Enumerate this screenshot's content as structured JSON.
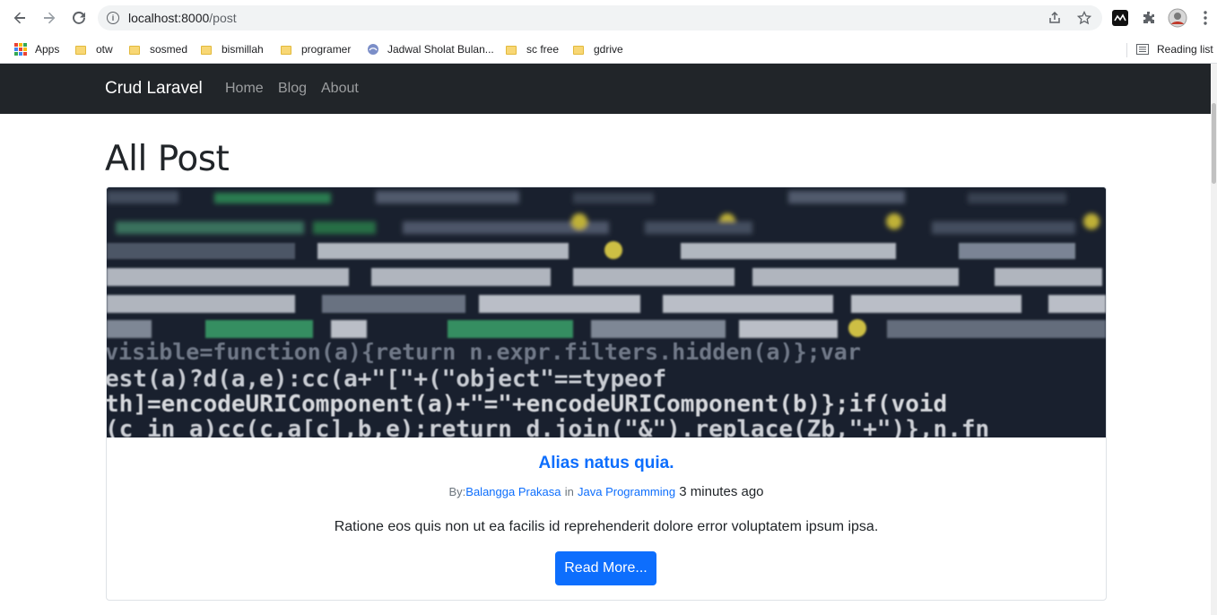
{
  "browser": {
    "url_host": "localhost:8000",
    "url_path": "/post",
    "bookmarks": [
      {
        "label": "Apps",
        "type": "apps"
      },
      {
        "label": "otw",
        "type": "folder"
      },
      {
        "label": "sosmed",
        "type": "folder"
      },
      {
        "label": "bismillah",
        "type": "folder"
      },
      {
        "label": "programer",
        "type": "folder"
      },
      {
        "label": "Jadwal Sholat Bulan...",
        "type": "site"
      },
      {
        "label": "sc free",
        "type": "folder"
      },
      {
        "label": "gdrive",
        "type": "folder"
      }
    ],
    "reading_list": "Reading list"
  },
  "navbar": {
    "brand": "Crud Laravel",
    "links": [
      "Home",
      "Blog",
      "About"
    ]
  },
  "main": {
    "title": "All Post"
  },
  "post": {
    "title": "Alias natus quia.",
    "by_label": "By:",
    "author": "Balangga Prakasa",
    "in_label": "in",
    "category": "Java Programming",
    "time": "3 minutes ago",
    "excerpt": "Ratione eos quis non ut ea facilis id reprehenderit dolore error voluptatem ipsum ipsa.",
    "button": "Read More...",
    "image_code_lines": [
      "visible=function(a){return n.expr.filters.hidden(a)};var",
      "est(a)?d(a,e):cc(a+\"[\"+(\"object\"==typeof",
      "th]=encodeURIComponent(a)+\"=\"+encodeURIComponent(b)};if(void",
      "(c in a)cc(c,a[c],b,e);return d.join(\"&\").replace(Zb,\"+\")},n.fn"
    ]
  },
  "colors": {
    "navbar_bg": "#212529",
    "link": "#0d6efd",
    "button_bg": "#0d6efd"
  }
}
